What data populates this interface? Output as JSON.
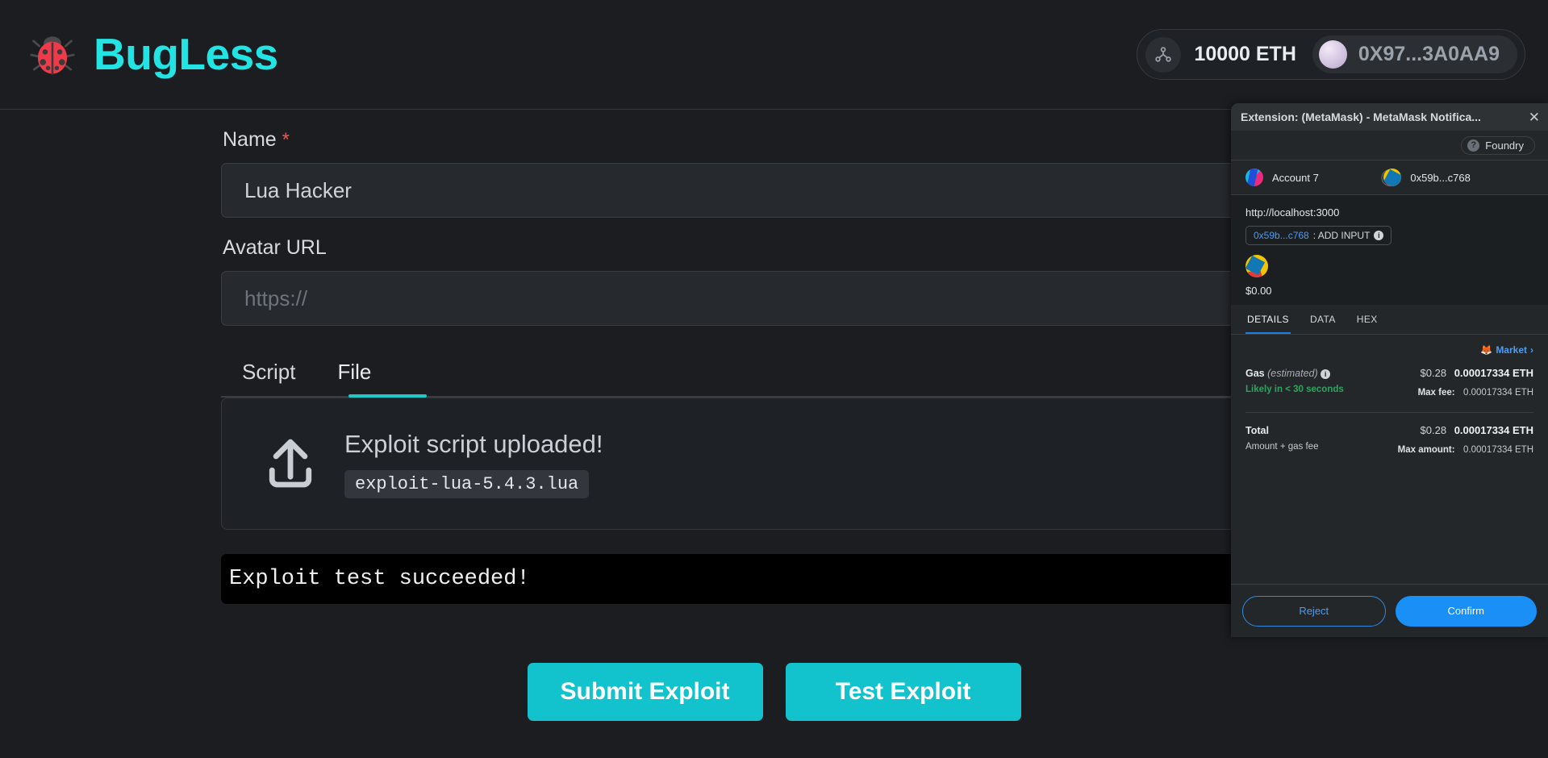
{
  "header": {
    "brand_name": "BugLess",
    "logo_icon": "ladybug-icon",
    "network_icon": "network-nodes-icon",
    "eth_balance": "10000 ETH",
    "wallet_address": "0X97...3A0AA9",
    "accent_color": "#22e4e4"
  },
  "form": {
    "name_label": "Name",
    "name_required_mark": "*",
    "name_value": "Lua Hacker",
    "name_placeholder": "Name",
    "avatar_label": "Avatar URL",
    "avatar_value": "",
    "avatar_placeholder": "https://",
    "tabs": [
      {
        "label": "Script",
        "active": false
      },
      {
        "label": "File",
        "active": true
      }
    ],
    "upload": {
      "icon": "upload-arrow-icon",
      "title": "Exploit script uploaded!",
      "filename": "exploit-lua-5.4.3.lua"
    },
    "console_output": "Exploit test succeeded!",
    "submit_label": "Submit Exploit",
    "test_label": "Test Exploit",
    "cta_color": "#12c2cd"
  },
  "metamask": {
    "window_title": "Extension: (MetaMask) - MetaMask Notifica...",
    "close_icon": "close-icon",
    "network": {
      "icon": "question-mark-icon",
      "name": "Foundry"
    },
    "from_account": "Account 7",
    "to_account": "0x59b...c768",
    "transfer_icon": "arrow-right-icon",
    "origin": "http://localhost:3000",
    "contract_address": "0x59b...c768",
    "contract_action": ": ADD INPUT",
    "info_icon": "info-icon",
    "amount": "$0.00",
    "tabs": [
      {
        "label": "DETAILS",
        "active": true
      },
      {
        "label": "DATA",
        "active": false
      },
      {
        "label": "HEX",
        "active": false
      }
    ],
    "market_label": "Market",
    "market_icon": "fox-icon",
    "market_chevron": "›",
    "gas": {
      "label": "Gas",
      "label_note": "(estimated)",
      "usd": "$0.28",
      "eth": "0.00017334 ETH",
      "speed": "Likely in < 30 seconds",
      "max_fee_label": "Max fee:",
      "max_fee_value": "0.00017334 ETH"
    },
    "total": {
      "label": "Total",
      "usd": "$0.28",
      "eth": "0.00017334 ETH",
      "sub_label": "Amount + gas fee",
      "max_amount_label": "Max amount:",
      "max_amount_value": "0.00017334 ETH"
    },
    "reject_label": "Reject",
    "confirm_label": "Confirm",
    "confirm_color": "#1a8ff5"
  }
}
